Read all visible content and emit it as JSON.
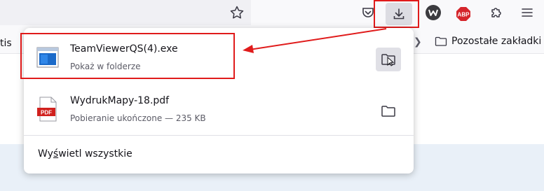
{
  "bookmarks_bar": {
    "left_fragment": "tis",
    "other_bookmarks": "Pozostałe zakładki"
  },
  "toolbar": {
    "abp_label": "ABP"
  },
  "downloads_panel": {
    "items": [
      {
        "file_name": "TeamViewerQS(4).exe",
        "status": "Pokaż w folderze",
        "icon": "exe-window-icon"
      },
      {
        "file_name": "WydrukMapy-18.pdf",
        "status": "Pobieranie ukończone — 235 KB",
        "icon": "pdf-file-icon",
        "icon_label": "PDF"
      }
    ],
    "show_all_prefix": "Wy",
    "show_all_underlined": "ś",
    "show_all_suffix": "wietl wszystkie"
  },
  "colors": {
    "highlight_red": "#e01b1b",
    "abp_red": "#d5252b",
    "pdf_red": "#d1211e"
  }
}
